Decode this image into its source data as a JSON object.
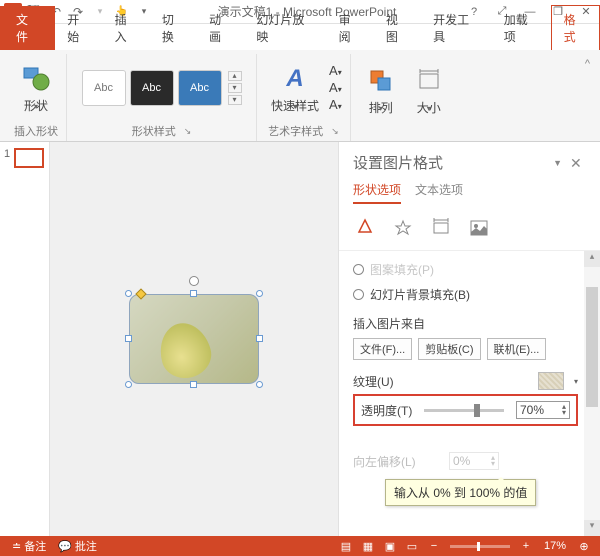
{
  "titlebar": {
    "app_glyph": "P",
    "title": "演示文稿1 - Microsoft PowerPoint",
    "help": "?",
    "full": "⤢",
    "min": "—",
    "restore": "❐",
    "close": "✕"
  },
  "ribbon_tabs": {
    "file": "文件",
    "home": "开始",
    "insert": "插入",
    "transitions": "切换",
    "animations": "动画",
    "slideshow": "幻灯片放映",
    "review": "审阅",
    "view": "视图",
    "developer": "开发工具",
    "addins": "加载项",
    "format": "格式"
  },
  "ribbon": {
    "shapes": {
      "label": "形状",
      "group": "插入形状"
    },
    "styles": {
      "sample": "Abc",
      "group": "形状样式"
    },
    "wordart": {
      "label": "快速样式",
      "group": "艺术字样式",
      "sample": "A"
    },
    "arrange": {
      "label": "排列"
    },
    "size": {
      "label": "大小"
    }
  },
  "thumbnail": {
    "num": "1"
  },
  "pane": {
    "title": "设置图片格式",
    "tab_shape": "形状选项",
    "tab_text": "文本选项",
    "radio_placeholder": "图案填充(P)",
    "radio_slidebg": "幻灯片背景填充(B)",
    "insert_from": "插入图片来自",
    "btn_file": "文件(F)...",
    "btn_clipboard": "剪贴板(C)",
    "btn_online": "联机(E)...",
    "texture": "纹理(U)",
    "transparency": "透明度(T)",
    "transparency_value": "70%",
    "tooltip": "输入从 0% 到 100% 的值",
    "offset": "向左偏移(L)",
    "offset_value": "0%"
  },
  "statusbar": {
    "notes": "备注",
    "comments": "批注",
    "zoom": "17%",
    "zoom_minus": "−",
    "zoom_plus": "+",
    "fit": "⊕"
  },
  "chart_data": null
}
